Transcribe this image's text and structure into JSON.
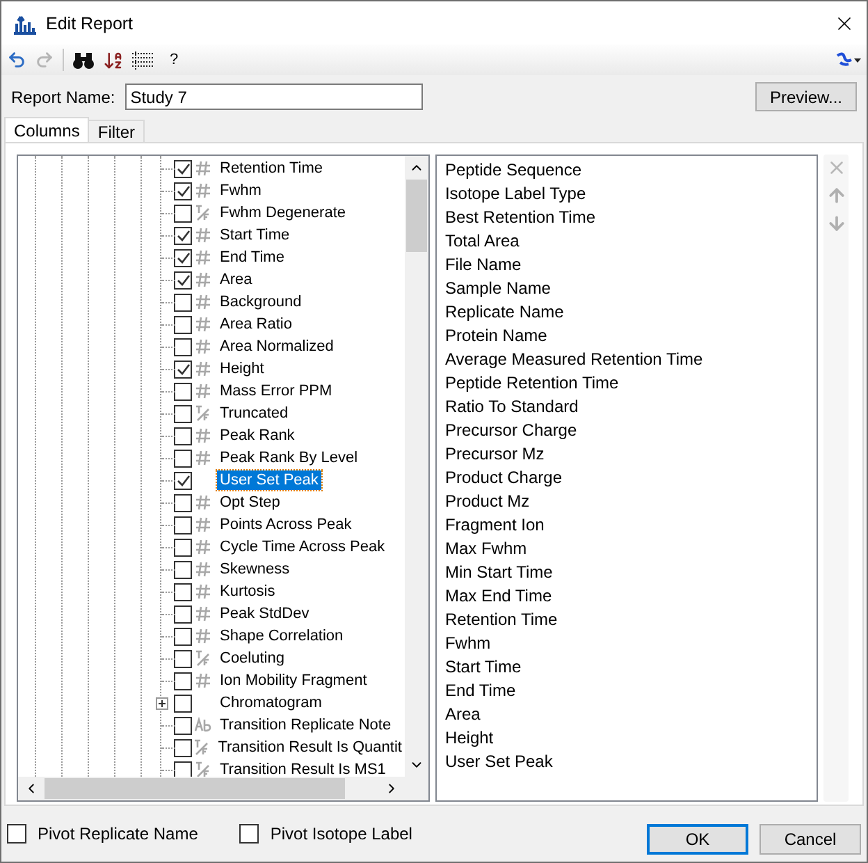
{
  "window": {
    "title": "Edit Report"
  },
  "toolbar": {
    "help": "?"
  },
  "report_name": {
    "label": "Report Name:",
    "value": "Study 7"
  },
  "preview_button": "Preview...",
  "tabs": [
    {
      "label": "Columns",
      "selected": true
    },
    {
      "label": "Filter",
      "selected": false
    }
  ],
  "tree": {
    "items": [
      {
        "label": "Retention Time",
        "kind": "number",
        "checked": true,
        "selected": false
      },
      {
        "label": "Fwhm",
        "kind": "number",
        "checked": true,
        "selected": false
      },
      {
        "label": "Fwhm Degenerate",
        "kind": "boolean",
        "checked": false,
        "selected": false
      },
      {
        "label": "Start Time",
        "kind": "number",
        "checked": true,
        "selected": false
      },
      {
        "label": "End Time",
        "kind": "number",
        "checked": true,
        "selected": false
      },
      {
        "label": "Area",
        "kind": "number",
        "checked": true,
        "selected": false
      },
      {
        "label": "Background",
        "kind": "number",
        "checked": false,
        "selected": false
      },
      {
        "label": "Area Ratio",
        "kind": "number",
        "checked": false,
        "selected": false
      },
      {
        "label": "Area Normalized",
        "kind": "number",
        "checked": false,
        "selected": false
      },
      {
        "label": "Height",
        "kind": "number",
        "checked": true,
        "selected": false
      },
      {
        "label": "Mass Error PPM",
        "kind": "number",
        "checked": false,
        "selected": false
      },
      {
        "label": "Truncated",
        "kind": "boolean",
        "checked": false,
        "selected": false
      },
      {
        "label": "Peak Rank",
        "kind": "number",
        "checked": false,
        "selected": false
      },
      {
        "label": "Peak Rank By Level",
        "kind": "number",
        "checked": false,
        "selected": false
      },
      {
        "label": "User Set Peak",
        "kind": "plain",
        "checked": true,
        "selected": true
      },
      {
        "label": "Opt Step",
        "kind": "number",
        "checked": false,
        "selected": false
      },
      {
        "label": "Points Across Peak",
        "kind": "number",
        "checked": false,
        "selected": false
      },
      {
        "label": "Cycle Time Across Peak",
        "kind": "number",
        "checked": false,
        "selected": false
      },
      {
        "label": "Skewness",
        "kind": "number",
        "checked": false,
        "selected": false
      },
      {
        "label": "Kurtosis",
        "kind": "number",
        "checked": false,
        "selected": false
      },
      {
        "label": "Peak StdDev",
        "kind": "number",
        "checked": false,
        "selected": false
      },
      {
        "label": "Shape Correlation",
        "kind": "number",
        "checked": false,
        "selected": false
      },
      {
        "label": "Coeluting",
        "kind": "boolean",
        "checked": false,
        "selected": false
      },
      {
        "label": "Ion Mobility Fragment",
        "kind": "number",
        "checked": false,
        "selected": false
      },
      {
        "label": "Chromatogram",
        "kind": "group",
        "checked": false,
        "selected": false,
        "expanded": false
      },
      {
        "label": "Transition Replicate Note",
        "kind": "text",
        "checked": false,
        "selected": false
      },
      {
        "label": "Transition Result Is Quantit",
        "kind": "boolean",
        "checked": false,
        "selected": false
      },
      {
        "label": "Transition Result Is MS1",
        "kind": "boolean",
        "checked": false,
        "selected": false
      }
    ]
  },
  "selected_columns": [
    "Peptide Sequence",
    "Isotope Label Type",
    "Best Retention Time",
    "Total Area",
    "File Name",
    "Sample Name",
    "Replicate Name",
    "Protein Name",
    "Average Measured Retention Time",
    "Peptide Retention Time",
    "Ratio To Standard",
    "Precursor Charge",
    "Precursor Mz",
    "Product Charge",
    "Product Mz",
    "Fragment Ion",
    "Max Fwhm",
    "Min Start Time",
    "Max End Time",
    "Retention Time",
    "Fwhm",
    "Start Time",
    "End Time",
    "Area",
    "Height",
    "User Set Peak"
  ],
  "options": [
    {
      "label": "Pivot Replicate Name",
      "checked": false
    },
    {
      "label": "Pivot Isotope Label",
      "checked": false
    }
  ],
  "buttons": [
    {
      "label": "OK",
      "default": true
    },
    {
      "label": "Cancel",
      "default": false
    }
  ]
}
